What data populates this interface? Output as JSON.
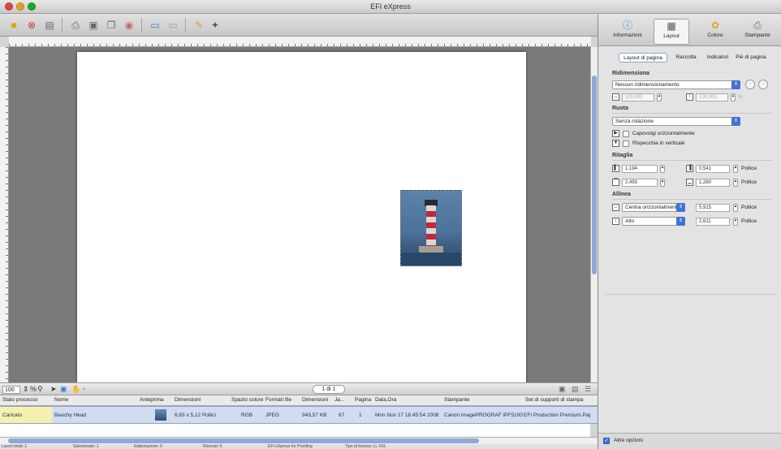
{
  "window": {
    "title": "EFI eXpress"
  },
  "toolbar": {
    "icons": [
      "folder-icon",
      "close-doc-icon",
      "save-icon",
      "print-icon",
      "preview-icon",
      "duplicate-icon",
      "help-icon",
      "screen-icon",
      "panel-icon",
      "pencil-icon",
      "wand-icon"
    ]
  },
  "canvas": {
    "zoom_value": "100",
    "zoom_unit": "%",
    "page_indicator": "1 di 1"
  },
  "table": {
    "columns": [
      "Stato processo",
      "Nome",
      "Anteprima",
      "Dimensioni",
      "Spazio colore",
      "Formati file",
      "Dimensioni",
      "Ja...",
      "Pagina",
      "Data,Ora",
      "Stampante",
      "Set di supporti di stampa"
    ],
    "rows": [
      {
        "status": "Caricato",
        "name": "Beachy Head",
        "dims": "6,83 x 5,12 Pollici",
        "color_space": "RGB",
        "format": "JPEG",
        "size": "943,57 KB",
        "ja": "67",
        "page": "1",
        "date": "Mon Nov 17 16:45:54 2008",
        "printer": "Canon imagePROGRAF iPF5100",
        "media": "EFI Production Premium Paper"
      }
    ]
  },
  "statusbar": {
    "items": [
      "Lavori totali: 1",
      "Selezionato: 1",
      "Elaborazione: 0",
      "Ricevuti: 0",
      "EFI eXpress for Proofing",
      "Tipo di licenza: LL XXL"
    ]
  },
  "panel": {
    "tabs": [
      {
        "label": "Informazioni",
        "icon": "info-icon"
      },
      {
        "label": "Layout",
        "icon": "layout-icon"
      },
      {
        "label": "Colore",
        "icon": "color-icon"
      },
      {
        "label": "Stampante",
        "icon": "printer-icon"
      }
    ],
    "subtabs": [
      "Layout di pagina",
      "Raccolta",
      "Indicatori",
      "Piè di pagina"
    ],
    "resize": {
      "title": "Ridimensiona",
      "mode": "Nessun ridimensionamento",
      "width": "100,000",
      "height": "100,000",
      "unit": "%"
    },
    "rotate": {
      "title": "Ruota",
      "mode": "Senza rotazione",
      "flip_h": "Capovolgi orizzontalmente",
      "flip_v": "Rispecchia in verticale"
    },
    "crop": {
      "title": "Ritaglia",
      "left": "1,194",
      "top": "0,541",
      "right": "2,493",
      "bottom": "1,260",
      "unit": "Pollice"
    },
    "align": {
      "title": "Allinea",
      "horizontal": "Centra orizzontalmente",
      "horizontal_value": "5,915",
      "vertical": "Alto",
      "vertical_value": "2,611",
      "unit": "Pollice"
    },
    "more_options": "Altre opzioni"
  }
}
